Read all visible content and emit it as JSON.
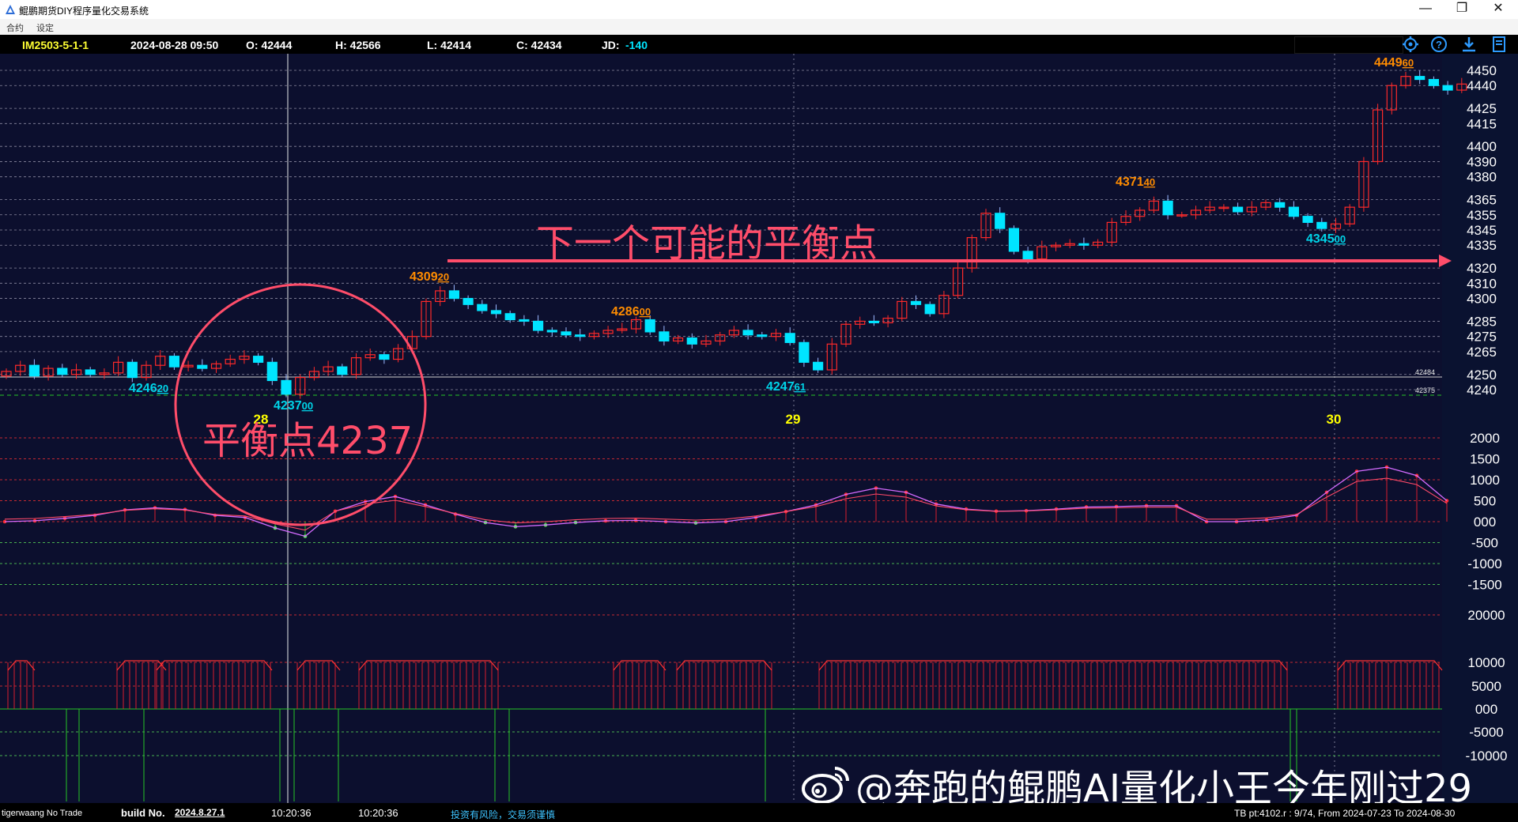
{
  "window": {
    "title": "鲲鹏期货DIY程序量化交易系统",
    "controls": {
      "minimize": "—",
      "restore": "❐",
      "close": "✕"
    }
  },
  "menu": [
    "合约",
    "设定"
  ],
  "info_bar": {
    "contract": "IM2503-5-1-1",
    "datetime": "2024-08-28 09:50",
    "open": "O: 42444",
    "high": "H: 42566",
    "low": "L: 42414",
    "close": "C: 42434",
    "jd_label": "JD:",
    "jd_value": "-140"
  },
  "toolbar_icons": [
    "gear-icon",
    "help-icon",
    "download-icon",
    "book-icon"
  ],
  "colors": {
    "background": "#0c0f2e",
    "up": "#ff2a2a",
    "down": "#00e5ff",
    "axis": "#ffffff",
    "high_label": "#ff8c00",
    "low_label": "#00d4e8",
    "annotation": "#ff4d6a",
    "grid": "#ff3333",
    "indicator_green": "#26c426",
    "day_label": "#ffff00"
  },
  "main_axis_labels": [
    "4450",
    "4440",
    "4425",
    "4415",
    "4400",
    "4390",
    "4380",
    "4365",
    "4355",
    "4345",
    "4335",
    "4320",
    "4310",
    "4300",
    "4285",
    "4275",
    "4265",
    "4250",
    "4240"
  ],
  "ref_tags": [
    "42484",
    "42375"
  ],
  "osc_axis_labels": [
    "2000",
    "1500",
    "1000",
    "500",
    "000",
    "-500",
    "-1000",
    "-1500"
  ],
  "vol_axis_labels": [
    "20000",
    "10000",
    "5000",
    "000",
    "-5000",
    "-10000"
  ],
  "day_labels": [
    "28",
    "29",
    "30"
  ],
  "price_labels": [
    {
      "main": "4246",
      "sub": "20",
      "kind": "low"
    },
    {
      "main": "4237",
      "sub": "00",
      "kind": "low"
    },
    {
      "main": "4309",
      "sub": "20",
      "kind": "high"
    },
    {
      "main": "4286",
      "sub": "00",
      "kind": "high"
    },
    {
      "main": "4247",
      "sub": "61",
      "kind": "low"
    },
    {
      "main": "4371",
      "sub": "40",
      "kind": "high"
    },
    {
      "main": "4345",
      "sub": "00",
      "kind": "low"
    },
    {
      "main": "4449",
      "sub": "60",
      "kind": "high"
    }
  ],
  "annotations": {
    "balance_point": "平衡点4237",
    "next_balance": "下一个可能的平衡点"
  },
  "chart_data": {
    "type": "candlestick",
    "series": [
      {
        "name": "close",
        "values": [
          4252,
          4256,
          4249,
          4254,
          4250,
          4253,
          4250,
          4251,
          4258,
          4248,
          4256,
          4262,
          4255,
          4256,
          4254,
          4257,
          4260,
          4262,
          4258,
          4246,
          4237,
          4248,
          4252,
          4255,
          4250,
          4261,
          4263,
          4260,
          4267,
          4275,
          4298,
          4305,
          4300,
          4296,
          4292,
          4290,
          4286,
          4285,
          4279,
          4278,
          4276,
          4275,
          4277,
          4279,
          4280,
          4286,
          4278,
          4272,
          4274,
          4270,
          4272,
          4276,
          4279,
          4276,
          4275,
          4277,
          4271,
          4258,
          4253,
          4270,
          4283,
          4285,
          4284,
          4287,
          4298,
          4296,
          4290,
          4302,
          4320,
          4340,
          4356,
          4346,
          4331,
          4326,
          4334,
          4335,
          4336,
          4335,
          4337,
          4350,
          4354,
          4358,
          4364,
          4355,
          4355,
          4358,
          4360,
          4360,
          4357,
          4360,
          4363,
          4360,
          4354,
          4350,
          4346,
          4349,
          4360,
          4390,
          4424,
          4440,
          4446,
          4444,
          4440,
          4437,
          4441
        ]
      },
      {
        "name": "oscillator",
        "values": [
          0,
          20,
          80,
          150,
          280,
          330,
          290,
          150,
          100,
          -150,
          -350,
          250,
          480,
          600,
          400,
          180,
          -20,
          -120,
          -80,
          -20,
          20,
          30,
          0,
          -30,
          0,
          100,
          240,
          400,
          650,
          800,
          700,
          420,
          300,
          250,
          260,
          300,
          350,
          360,
          380,
          380,
          0,
          0,
          40,
          150,
          700,
          1200,
          1300,
          1100,
          500
        ]
      }
    ],
    "ylim": [
      4237,
      4450
    ],
    "day_labels": [
      "28",
      "29",
      "30"
    ]
  },
  "watermark": "@奔跑的鲲鹏AI量化小王今年刚过29",
  "status": {
    "left": "tigerwaang No Trade",
    "build_label": "build No.",
    "build_value": "2024.8.27.1",
    "time1": "10:20:36",
    "time2": "10:20:36",
    "risk": "投资有风险，交易须谨慎",
    "range": "TB pt:4102.r : 9/74, From 2024-07-23   To 2024-08-30"
  }
}
